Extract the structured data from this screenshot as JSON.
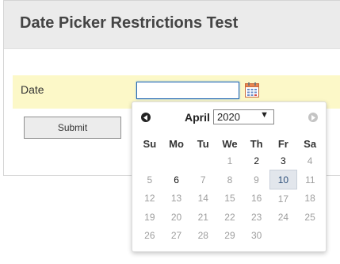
{
  "page": {
    "title": "Date Picker Restrictions Test"
  },
  "form": {
    "date_label": "Date",
    "date_value": "",
    "calendar_icon": "calendar-icon",
    "submit_label": "Submit"
  },
  "datepicker": {
    "month": "April",
    "year": "2020",
    "prev_icon": "prev-arrow-icon",
    "next_icon": "next-arrow-icon",
    "weekdays": [
      "Su",
      "Mo",
      "Tu",
      "We",
      "Th",
      "Fr",
      "Sa"
    ],
    "weeks": [
      [
        {
          "day": "",
          "enabled": false
        },
        {
          "day": "",
          "enabled": false
        },
        {
          "day": "",
          "enabled": false
        },
        {
          "day": "1",
          "enabled": false
        },
        {
          "day": "2",
          "enabled": true
        },
        {
          "day": "3",
          "enabled": true
        },
        {
          "day": "4",
          "enabled": false
        }
      ],
      [
        {
          "day": "5",
          "enabled": false
        },
        {
          "day": "6",
          "enabled": true
        },
        {
          "day": "7",
          "enabled": false
        },
        {
          "day": "8",
          "enabled": false
        },
        {
          "day": "9",
          "enabled": false
        },
        {
          "day": "10",
          "enabled": true,
          "today": true
        },
        {
          "day": "11",
          "enabled": false
        }
      ],
      [
        {
          "day": "12",
          "enabled": false
        },
        {
          "day": "13",
          "enabled": false
        },
        {
          "day": "14",
          "enabled": false
        },
        {
          "day": "15",
          "enabled": false
        },
        {
          "day": "16",
          "enabled": false
        },
        {
          "day": "17",
          "enabled": false
        },
        {
          "day": "18",
          "enabled": false
        }
      ],
      [
        {
          "day": "19",
          "enabled": false
        },
        {
          "day": "20",
          "enabled": false
        },
        {
          "day": "21",
          "enabled": false
        },
        {
          "day": "22",
          "enabled": false
        },
        {
          "day": "23",
          "enabled": false
        },
        {
          "day": "24",
          "enabled": false
        },
        {
          "day": "25",
          "enabled": false
        }
      ],
      [
        {
          "day": "26",
          "enabled": false
        },
        {
          "day": "27",
          "enabled": false
        },
        {
          "day": "28",
          "enabled": false
        },
        {
          "day": "29",
          "enabled": false
        },
        {
          "day": "30",
          "enabled": false
        },
        {
          "day": "",
          "enabled": false
        },
        {
          "day": "",
          "enabled": false
        }
      ]
    ]
  },
  "colors": {
    "header_bg": "#ebebeb",
    "highlight_row_bg": "#fcf8c8",
    "input_focus_border": "#2a6db5",
    "today_bg": "#e2e6ec",
    "disabled_day": "#9e9e9e"
  }
}
